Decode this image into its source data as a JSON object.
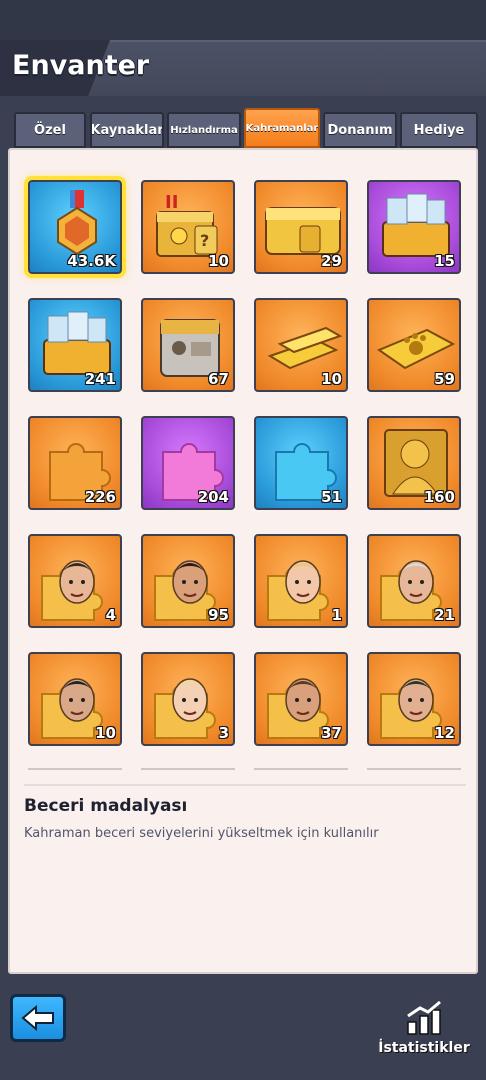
{
  "header": {
    "title": "Envanter"
  },
  "tabs": [
    {
      "label": "Özel"
    },
    {
      "label": "Kaynaklar"
    },
    {
      "label": "Hızlandırma"
    },
    {
      "label": "Kahramanlar"
    },
    {
      "label": "Donanım"
    },
    {
      "label": "Hediye"
    }
  ],
  "active_tab": "Kahramanlar",
  "items": [
    {
      "icon": "skill-medal-icon",
      "count": "43.6K",
      "bg": "blue"
    },
    {
      "icon": "hero-chest-tier-2-icon",
      "count": "10",
      "bg": "orange"
    },
    {
      "icon": "golden-hero-chest-icon",
      "count": "29",
      "bg": "orange"
    },
    {
      "icon": "exp-books-crate-icon",
      "count": "15",
      "bg": "purple"
    },
    {
      "icon": "exp-books-crate-icon",
      "count": "241",
      "bg": "blue"
    },
    {
      "icon": "supply-crate-icon",
      "count": "67",
      "bg": "orange"
    },
    {
      "icon": "gold-bars-icon",
      "count": "10",
      "bg": "orange"
    },
    {
      "icon": "paw-gold-bar-icon",
      "count": "59",
      "bg": "orange"
    },
    {
      "icon": "orange-puzzle-piece-icon",
      "count": "226",
      "bg": "orange"
    },
    {
      "icon": "purple-puzzle-piece-icon",
      "count": "204",
      "bg": "purple"
    },
    {
      "icon": "blue-puzzle-piece-icon",
      "count": "51",
      "bg": "blue"
    },
    {
      "icon": "golden-hero-bust-icon",
      "count": "160",
      "bg": "orange"
    },
    {
      "icon": "hero-shard-tophat-man-icon",
      "count": "4",
      "bg": "orange"
    },
    {
      "icon": "hero-shard-cigar-man-icon",
      "count": "95",
      "bg": "orange"
    },
    {
      "icon": "hero-shard-blonde-woman-icon",
      "count": "1",
      "bg": "orange"
    },
    {
      "icon": "hero-shard-old-man-icon",
      "count": "21",
      "bg": "orange"
    },
    {
      "icon": "hero-shard-scarred-man-icon",
      "count": "10",
      "bg": "orange"
    },
    {
      "icon": "hero-shard-curly-woman-icon",
      "count": "3",
      "bg": "orange"
    },
    {
      "icon": "hero-shard-bearded-man-icon",
      "count": "37",
      "bg": "orange"
    },
    {
      "icon": "hero-shard-beret-man-icon",
      "count": "12",
      "bg": "orange"
    }
  ],
  "selected_item": {
    "name": "Beceri madalyası",
    "description": "Kahraman beceri seviyelerini yükseltmek için kullanılır"
  },
  "footer": {
    "stats_label": "İstatistikler"
  },
  "colors": {
    "accent": "#f47d1b",
    "panel": "#faf0ee",
    "background": "#3a3f52"
  }
}
